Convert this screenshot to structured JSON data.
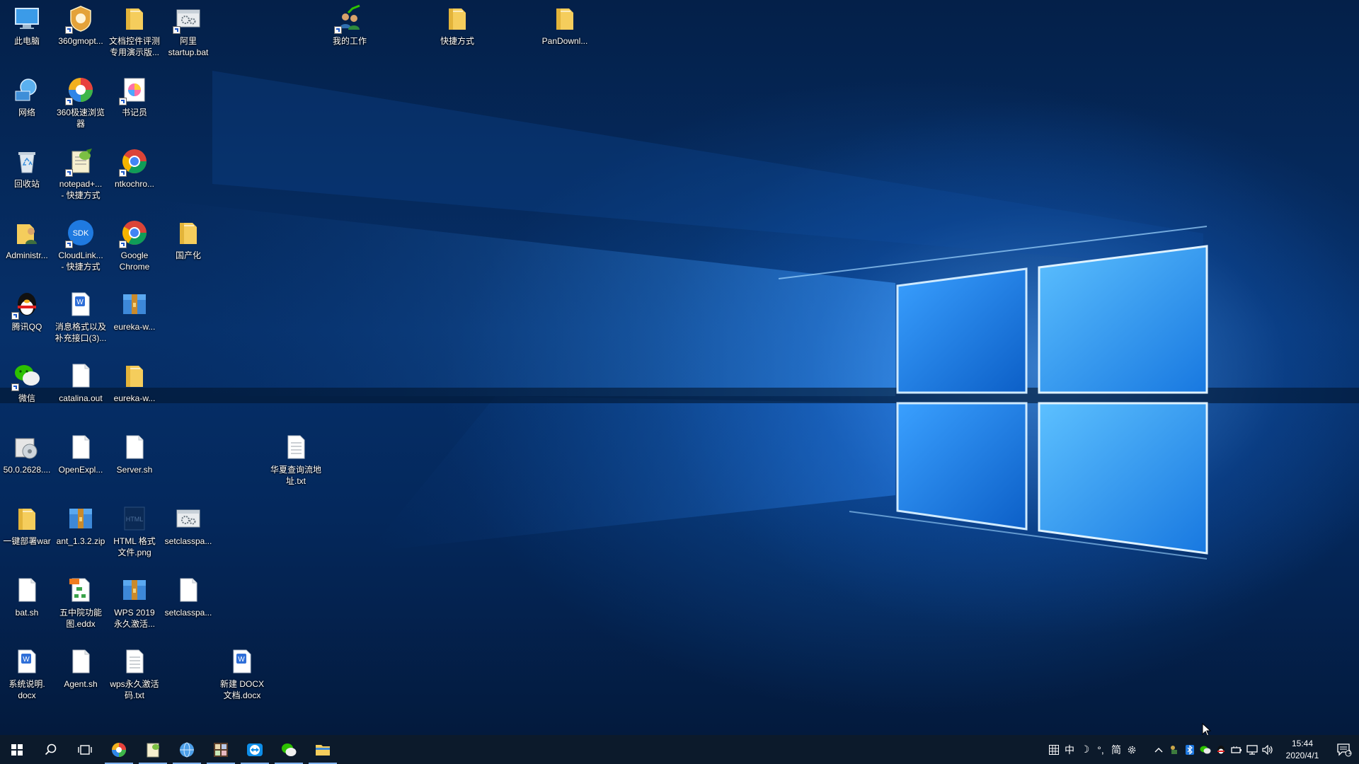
{
  "desktop": {
    "icons": [
      {
        "label": "此电脑",
        "icon": "this-pc-icon",
        "shortcut": false
      },
      {
        "label": "360gmopt...",
        "icon": "360-optimizer-icon",
        "shortcut": true
      },
      {
        "label": "文档控件评测专用演示版...",
        "icon": "folder-icon",
        "shortcut": false
      },
      {
        "label": "阿里\nstartup.bat",
        "icon": "batch-file-icon",
        "shortcut": true
      },
      {
        "label": "网络",
        "icon": "network-icon",
        "shortcut": false
      },
      {
        "label": "360极速浏览器",
        "icon": "360-browser-icon",
        "shortcut": true
      },
      {
        "label": "书记员",
        "icon": "pinwheel-app-icon",
        "shortcut": true
      },
      {
        "label": "回收站",
        "icon": "recycle-bin-icon",
        "shortcut": false
      },
      {
        "label": "notepad+...\n- 快捷方式",
        "icon": "notepad-plus-plus-icon",
        "shortcut": true
      },
      {
        "label": "ntkochro...",
        "icon": "chrome-icon",
        "shortcut": true
      },
      {
        "label": "Administr...",
        "icon": "user-folder-icon",
        "shortcut": false
      },
      {
        "label": "CloudLink...\n- 快捷方式",
        "icon": "sdk-icon",
        "shortcut": true
      },
      {
        "label": "Google\nChrome",
        "icon": "chrome-icon",
        "shortcut": true
      },
      {
        "label": "国产化",
        "icon": "folder-icon",
        "shortcut": false
      },
      {
        "label": "腾讯QQ",
        "icon": "qq-penguin-icon",
        "shortcut": true
      },
      {
        "label": "消息格式以及补充接口(3)...",
        "icon": "wps-doc-icon",
        "shortcut": false
      },
      {
        "label": "eureka-w...",
        "icon": "archive-icon",
        "shortcut": false
      },
      {
        "label": "微信",
        "icon": "wechat-icon",
        "shortcut": true
      },
      {
        "label": "catalina.out",
        "icon": "blank-file-icon",
        "shortcut": false
      },
      {
        "label": "eureka-w...",
        "icon": "folder-icon",
        "shortcut": false
      },
      {
        "label": "50.0.2628....",
        "icon": "installer-icon",
        "shortcut": false
      },
      {
        "label": "OpenExpl...",
        "icon": "blank-file-icon",
        "shortcut": false
      },
      {
        "label": "Server.sh",
        "icon": "blank-file-icon",
        "shortcut": false
      },
      {
        "label": "华夏查询流地址.txt",
        "icon": "text-file-icon",
        "shortcut": false
      },
      {
        "label": "一键部署war",
        "icon": "folder-icon",
        "shortcut": false
      },
      {
        "label": "ant_1.3.2.zip",
        "icon": "archive-icon",
        "shortcut": false
      },
      {
        "label": "HTML 格式\n文件.png",
        "icon": "image-file-icon",
        "shortcut": false
      },
      {
        "label": "setclasspa...",
        "icon": "batch-file-icon",
        "shortcut": false
      },
      {
        "label": "bat.sh",
        "icon": "blank-file-icon",
        "shortcut": false
      },
      {
        "label": "五中院功能\n图.eddx",
        "icon": "edraw-file-icon",
        "shortcut": false
      },
      {
        "label": "WPS 2019\n永久激活...",
        "icon": "archive-icon",
        "shortcut": false
      },
      {
        "label": "setclasspa...",
        "icon": "blank-file-icon",
        "shortcut": false
      },
      {
        "label": "系统说明.\ndocx",
        "icon": "wps-doc-icon",
        "shortcut": false
      },
      {
        "label": "Agent.sh",
        "icon": "blank-file-icon",
        "shortcut": false
      },
      {
        "label": "wps永久激活\n码.txt",
        "icon": "text-file-icon",
        "shortcut": false
      },
      {
        "label": "新建 DOCX\n文档.docx",
        "icon": "wps-doc-icon",
        "shortcut": false
      },
      {
        "label": "我的工作",
        "icon": "user-group-icon",
        "shortcut": true
      },
      {
        "label": "快捷方式",
        "icon": "folder-icon",
        "shortcut": false
      },
      {
        "label": "PanDownl...",
        "icon": "folder-icon",
        "shortcut": false
      }
    ]
  },
  "taskbar": {
    "start_icon": "windows-logo-icon",
    "search_icon": "search-icon",
    "task_view_icon": "task-view-icon",
    "apps": [
      {
        "name": "360-browser-taskbar",
        "icon": "360-browser-icon",
        "active": true
      },
      {
        "name": "notepad-plus-plus-taskbar",
        "icon": "notepad-plus-plus-icon",
        "active": true
      },
      {
        "name": "browser-globe-taskbar",
        "icon": "globe-icon",
        "active": true
      },
      {
        "name": "app-grid-taskbar",
        "icon": "app-grid-icon",
        "active": true
      },
      {
        "name": "teamviewer-taskbar",
        "icon": "teamviewer-icon",
        "active": true
      },
      {
        "name": "wechat-taskbar",
        "icon": "wechat-icon",
        "active": true
      },
      {
        "name": "file-explorer-taskbar",
        "icon": "file-explorer-icon",
        "active": true
      }
    ],
    "tray": {
      "ime_items": [
        "中",
        "☽",
        "°,",
        "简"
      ],
      "time": "15:44",
      "date": "2020/4/1",
      "notification_count": "1"
    }
  },
  "colors": {
    "desktop_bg": "#042049",
    "taskbar_bg": "#0c1a2b",
    "windows_logo_blue": "#4aa8ff",
    "active_indicator": "#7fb2ef"
  }
}
